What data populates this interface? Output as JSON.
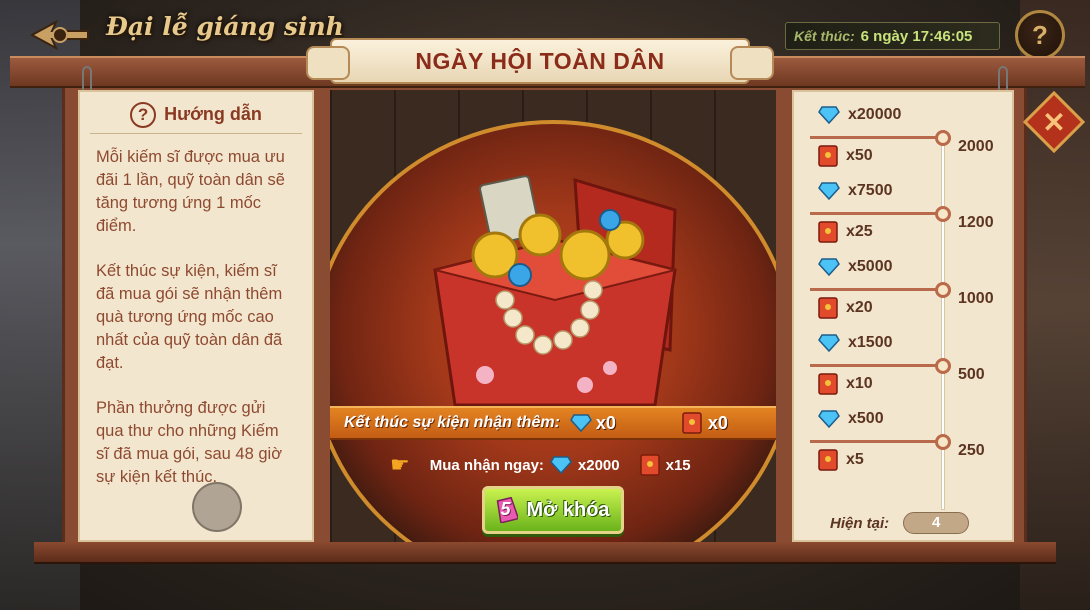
{
  "header": {
    "event_title": "Đại lễ giáng sinh",
    "timer_label": "Kết thúc:",
    "timer_value": "6 ngày 17:46:05",
    "help_label": "?"
  },
  "plaque": {
    "title": "NGÀY HỘI TOÀN DÂN"
  },
  "guide": {
    "title": "Hướng dẫn",
    "icon_label": "?",
    "paragraphs": [
      "Mỗi kiếm sĩ được mua ưu đãi 1 lần, quỹ toàn dân sẽ tăng tương ứng 1 mốc điểm.",
      "Kết thúc sự kiện, kiếm sĩ đã mua gói sẽ nhận thêm quà tương ứng mốc cao nhất của quỹ toàn dân đã đạt.",
      "Phần thưởng được gửi qua thư cho những Kiếm sĩ đã mua gói, sau 48 giờ sự kiện kết thúc."
    ]
  },
  "center": {
    "reward_label": "Kết thúc sự kiện nhận thêm:",
    "reward_gem": "x0",
    "reward_env": "x0",
    "buy_label": "Mua nhận ngay:",
    "buy_gem": "x2000",
    "buy_env": "x15",
    "unlock_label": "Mở khóa",
    "unlock_cost": "5"
  },
  "milestones": {
    "items": [
      {
        "gem": "x20000",
        "env": "x50",
        "points": "2000"
      },
      {
        "gem": "x7500",
        "env": "x25",
        "points": "1200"
      },
      {
        "gem": "x5000",
        "env": "x20",
        "points": "1000"
      },
      {
        "gem": "x1500",
        "env": "x10",
        "points": "500"
      },
      {
        "gem": "x500",
        "env": "x5",
        "points": "250"
      }
    ],
    "current_label": "Hiện tại:",
    "current_value": "4"
  },
  "colors": {
    "frame": "#8a4b33",
    "parchment": "#f3e6cf",
    "accent_red": "#8a2c19",
    "button_green": "#6ab31b",
    "gem_blue": "#3aa6e8"
  },
  "icons": [
    "back-arrow-icon",
    "help-icon",
    "close-icon",
    "question-icon",
    "diamond-icon",
    "red-envelope-icon",
    "pointing-hand-icon",
    "pink-ticket-icon"
  ]
}
